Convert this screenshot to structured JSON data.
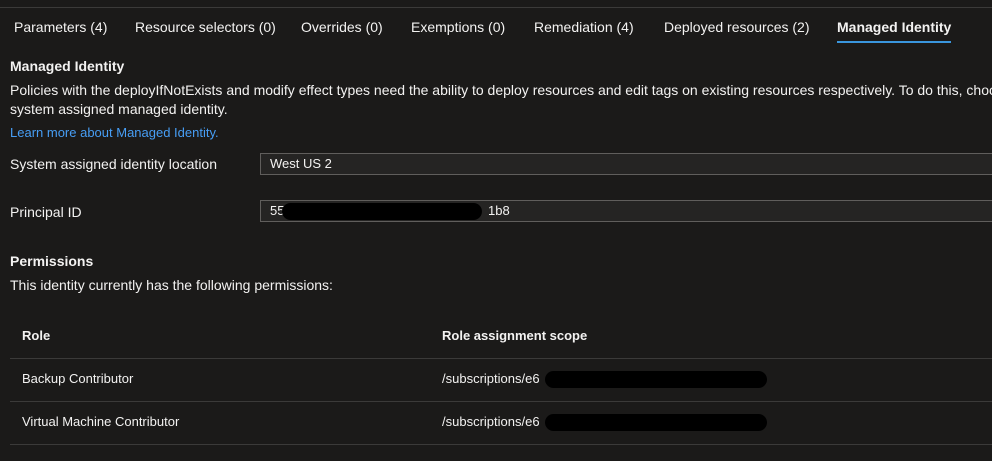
{
  "tabs": [
    {
      "label": "Parameters (4)"
    },
    {
      "label": "Resource selectors (0)"
    },
    {
      "label": "Overrides (0)"
    },
    {
      "label": "Exemptions (0)"
    },
    {
      "label": "Remediation (4)"
    },
    {
      "label": "Deployed resources (2)"
    },
    {
      "label": "Managed Identity"
    }
  ],
  "active_tab": "Managed Identity",
  "managed_identity": {
    "title": "Managed Identity",
    "description_line1": "Policies with the deployIfNotExists and modify effect types need the ability to deploy resources and edit tags on existing resources respectively. To do this, choo",
    "description_line2": "system assigned managed identity.",
    "learn_more": "Learn more about Managed Identity."
  },
  "fields": {
    "location_label": "System assigned identity location",
    "location_value": "West US 2",
    "principal_label": "Principal ID",
    "principal_prefix": "55",
    "principal_suffix": "1b8"
  },
  "permissions": {
    "title": "Permissions",
    "description": "This identity currently has the following permissions:",
    "columns": [
      "Role",
      "Role assignment scope"
    ],
    "rows": [
      {
        "role": "Backup Contributor",
        "scope": "/subscriptions/e6"
      },
      {
        "role": "Virtual Machine Contributor",
        "scope": "/subscriptions/e6"
      }
    ]
  },
  "colors": {
    "background": "#1b1a19",
    "accent": "#3a96dd",
    "link": "#479ef5"
  }
}
